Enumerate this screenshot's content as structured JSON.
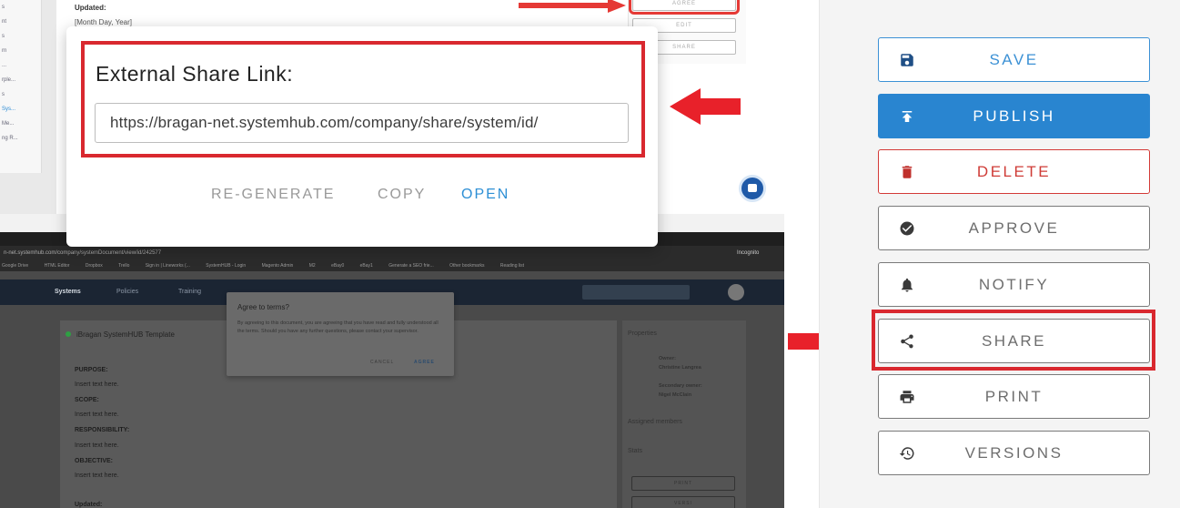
{
  "modal": {
    "title": "External Share Link:",
    "share_url": "https://bragan-net.systemhub.com/company/share/system/id/",
    "actions": {
      "regenerate": "RE-GENERATE",
      "copy": "COPY",
      "open": "OPEN"
    }
  },
  "sidebar": {
    "save": "SAVE",
    "publish": "PUBLISH",
    "delete": "DELETE",
    "approve": "APPROVE",
    "notify": "NOTIFY",
    "share": "SHARE",
    "print": "PRINT",
    "versions": "VERSIONS"
  },
  "background_top": {
    "updated_label": "Updated:",
    "updated_date": "[Month Day, Year]",
    "buttons": [
      "AGREE",
      "EDIT",
      "SHARE"
    ],
    "sidebar_items": [
      "s",
      "nt",
      "s",
      "rn",
      "...",
      "rple...",
      "s",
      "Sys...",
      "Me...",
      "ng R..."
    ]
  },
  "background_browser": {
    "url": "n-net.systemhub.com/company/systemDocument/view/id/242577",
    "incognito": "Incognito",
    "bookmarks": [
      "Google Drive",
      "HTML Editor",
      "Dropbox",
      "Trello",
      "Sign in | Lineworks (...",
      "SystemHUB - Login",
      "Magento Admin",
      "M2",
      "eBay0",
      "eBay1",
      "Generate a SEO frie...",
      "Other bookmarks",
      "Reading list"
    ],
    "nav": [
      "Systems",
      "Policies",
      "Training"
    ],
    "doc_title": "iBragan SystemHUB Template",
    "doc_lines": [
      {
        "text": "PURPOSE:",
        "bold": true
      },
      {
        "text": "Insert text here.",
        "bold": false
      },
      {
        "text": "SCOPE:",
        "bold": true
      },
      {
        "text": "Insert text here.",
        "bold": false
      },
      {
        "text": "RESPONSIBILITY:",
        "bold": true
      },
      {
        "text": "Insert text here.",
        "bold": false
      },
      {
        "text": "OBJECTIVE:",
        "bold": true
      },
      {
        "text": "Insert text here.",
        "bold": false
      },
      {
        "text": "Updated:",
        "bold": true
      }
    ],
    "properties": {
      "title": "Properties",
      "owner_label": "Owner:",
      "owner": "Christine Langrea",
      "secondary_label": "Secondary owner:",
      "secondary": "Nigel McClain",
      "assigned": "Assigned members",
      "stats": "Stats",
      "mini_buttons": [
        "PRINT",
        "VERSI"
      ]
    },
    "terms_dialog": {
      "title": "Agree to terms?",
      "body": "By agreeing to this document, you are agreeing that you have read and fully understood all the terms. Should you have any further questions, please contact your supervisor.",
      "cancel": "CANCEL",
      "agree": "AGREE"
    }
  },
  "colors": {
    "accent_blue": "#2985d0",
    "danger_red": "#d33a37",
    "annotation_red": "#d9282f"
  }
}
